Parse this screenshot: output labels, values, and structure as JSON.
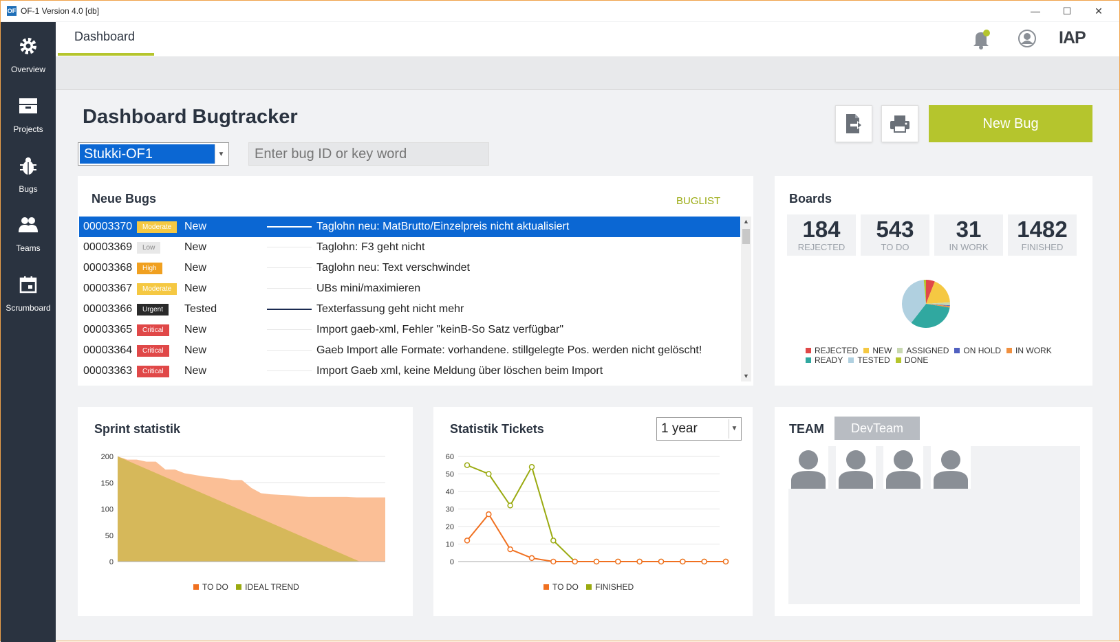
{
  "titlebar": {
    "badge": "OF",
    "title": "OF-1   Version 4.0  [db]",
    "minimize": "—",
    "maximize": "☐",
    "close": "✕"
  },
  "sidebar": {
    "items": [
      {
        "label": "Overview",
        "icon": "gear-icon"
      },
      {
        "label": "Projects",
        "icon": "projects-icon"
      },
      {
        "label": "Bugs",
        "icon": "bug-icon"
      },
      {
        "label": "Teams",
        "icon": "team-icon"
      },
      {
        "label": "Scrumboard",
        "icon": "calendar-icon"
      }
    ]
  },
  "header": {
    "tab": "Dashboard",
    "logo": "IAP",
    "accent": "#b5c52d"
  },
  "main": {
    "title": "Dashboard Bugtracker",
    "project": "Stukki-OF1",
    "search_placeholder": "Enter bug ID or key word",
    "new_bug_label": "New Bug"
  },
  "neue_bugs": {
    "title": "Neue Bugs",
    "buglist_link": "BUGLIST",
    "rows": [
      {
        "id": "00003370",
        "priority": "Moderate",
        "status": "New",
        "text": "Taglohn neu: MatBrutto/Einzelpreis nicht aktualisiert",
        "selected": true
      },
      {
        "id": "00003369",
        "priority": "Low",
        "status": "New",
        "text": "Taglohn: F3 geht nicht"
      },
      {
        "id": "00003368",
        "priority": "High",
        "status": "New",
        "text": "Taglohn neu: Text verschwindet"
      },
      {
        "id": "00003367",
        "priority": "Moderate",
        "status": "New",
        "text": "UBs mini/maximieren"
      },
      {
        "id": "00003366",
        "priority": "Urgent",
        "status": "Tested",
        "text": "Texterfassung geht nicht mehr"
      },
      {
        "id": "00003365",
        "priority": "Critical",
        "status": "New",
        "text": "Import gaeb-xml, Fehler \"keinB-So Satz verfügbar\""
      },
      {
        "id": "00003364",
        "priority": "Critical",
        "status": "New",
        "text": "Gaeb Import alle Formate: vorhandene. stillgelegte Pos. werden nicht gelöscht!"
      },
      {
        "id": "00003363",
        "priority": "Critical",
        "status": "New",
        "text": "Import Gaeb xml, keine Meldung über löschen beim Import"
      }
    ],
    "priority_colors": {
      "Moderate": "#f5c842",
      "Low": "#e8e8e8",
      "High": "#f0a020",
      "Urgent": "#2a2a2a",
      "Critical": "#e04848"
    }
  },
  "boards": {
    "title": "Boards",
    "stats": [
      {
        "value": "184",
        "label": "REJECTED"
      },
      {
        "value": "543",
        "label": "TO DO"
      },
      {
        "value": "31",
        "label": "IN WORK"
      },
      {
        "value": "1482",
        "label": "FINISHED"
      }
    ],
    "legend": [
      {
        "name": "REJECTED",
        "color": "#e04848"
      },
      {
        "name": "NEW",
        "color": "#f5c842"
      },
      {
        "name": "ASSIGNED",
        "color": "#c8d8b0"
      },
      {
        "name": "ON HOLD",
        "color": "#5060c0"
      },
      {
        "name": "IN WORK",
        "color": "#f09040"
      },
      {
        "name": "READY",
        "color": "#30a8a0"
      },
      {
        "name": "TESTED",
        "color": "#b0d0e0"
      },
      {
        "name": "DONE",
        "color": "#b5c52d"
      }
    ]
  },
  "sprint": {
    "title": "Sprint statistik",
    "legend": [
      {
        "name": "TO DO",
        "color": "#f07020"
      },
      {
        "name": "IDEAL TREND",
        "color": "#9aaa10"
      }
    ]
  },
  "tickets": {
    "title": "Statistik Tickets",
    "range": "1 year",
    "legend": [
      {
        "name": "TO DO",
        "color": "#f07020"
      },
      {
        "name": "FINISHED",
        "color": "#9aaa10"
      }
    ]
  },
  "team": {
    "title": "TEAM",
    "team_name": "DevTeam"
  },
  "chart_data": [
    {
      "type": "area",
      "title": "Sprint statistik",
      "ylim": [
        0,
        200
      ],
      "yticks": [
        "0",
        "50",
        "100",
        "150",
        "200"
      ],
      "series": [
        {
          "name": "TO DO",
          "values": [
            200,
            194,
            194,
            190,
            190,
            175,
            175,
            168,
            165,
            162,
            160,
            158,
            155,
            155,
            140,
            130,
            128,
            127,
            126,
            124,
            123,
            123,
            123,
            123,
            123,
            122,
            122,
            122,
            122
          ]
        },
        {
          "name": "IDEAL TREND",
          "values": [
            200,
            0
          ]
        }
      ]
    },
    {
      "type": "line",
      "title": "Statistik Tickets",
      "ylim": [
        0,
        60
      ],
      "yticks": [
        "0",
        "10",
        "20",
        "30",
        "40",
        "50",
        "60"
      ],
      "series": [
        {
          "name": "TO DO",
          "values": [
            12,
            27,
            7,
            2,
            0,
            0,
            0,
            0,
            0,
            0,
            0,
            0,
            0
          ]
        },
        {
          "name": "FINISHED",
          "values": [
            55,
            50,
            32,
            54,
            12,
            0,
            0,
            0,
            0,
            0,
            0,
            0,
            0
          ]
        }
      ]
    },
    {
      "type": "pie",
      "labels": [
        "REJECTED",
        "NEW",
        "ASSIGNED",
        "ON HOLD",
        "IN WORK",
        "READY",
        "TESTED",
        "DONE"
      ],
      "values": [
        6,
        18,
        2,
        0.5,
        1,
        33,
        38,
        1.5
      ]
    }
  ]
}
